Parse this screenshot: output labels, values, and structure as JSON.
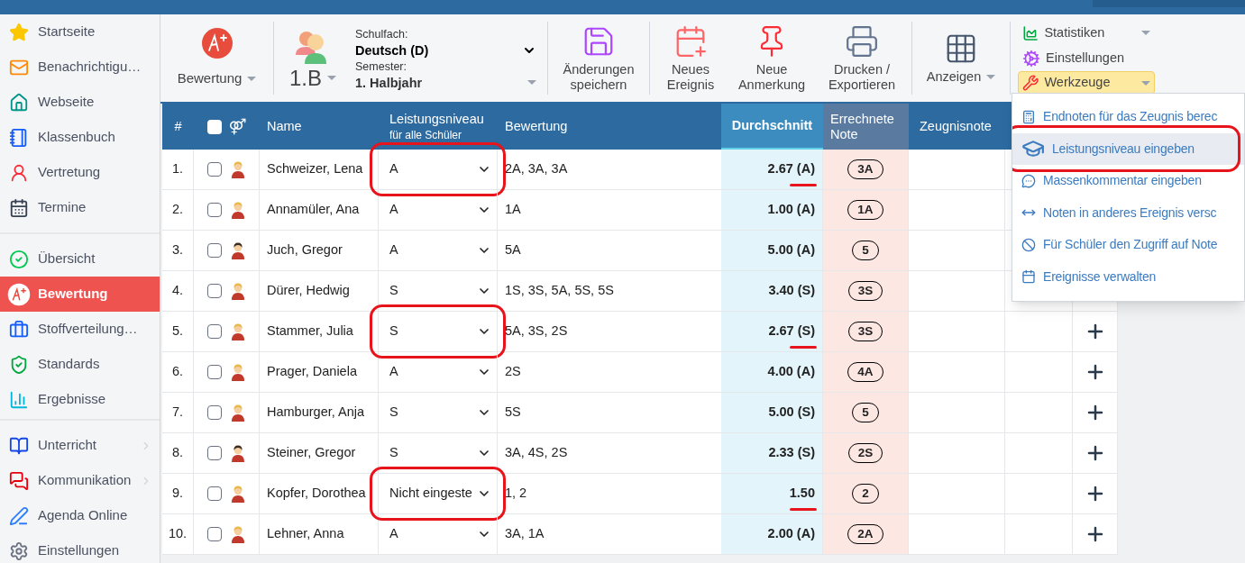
{
  "sidebar": {
    "groups": [
      {
        "items": [
          {
            "label": "Startseite",
            "selected": false
          },
          {
            "label": "Benachrichtigu…",
            "selected": false
          },
          {
            "label": "Webseite",
            "selected": false
          },
          {
            "label": "Klassenbuch",
            "selected": false
          },
          {
            "label": "Vertretung",
            "selected": false
          },
          {
            "label": "Termine",
            "selected": false
          }
        ]
      },
      {
        "items": [
          {
            "label": "Übersicht",
            "selected": false
          },
          {
            "label": "Bewertung",
            "selected": true
          },
          {
            "label": "Stoffverteilung…",
            "selected": false
          },
          {
            "label": "Standards",
            "selected": false
          },
          {
            "label": "Ergebnisse",
            "selected": false
          }
        ]
      },
      {
        "items": [
          {
            "label": "Unterricht",
            "selected": false,
            "submenu": true
          },
          {
            "label": "Kommunikation",
            "selected": false,
            "submenu": true
          },
          {
            "label": "Agenda Online",
            "selected": false,
            "submenu": false
          },
          {
            "label": "Einstellungen",
            "selected": false,
            "submenu": false
          }
        ]
      }
    ]
  },
  "toolbar": {
    "module": {
      "label": "Bewertung"
    },
    "class": {
      "label": "1.B"
    },
    "subject": {
      "label": "Schulfach:",
      "value": "Deutsch (D)"
    },
    "semester": {
      "label": "Semester:",
      "value": "1. Halbjahr"
    },
    "buttons": [
      {
        "label": "Änderungen speichern"
      },
      {
        "label": "Neues Ereignis"
      },
      {
        "label": "Neue Anmerkung"
      },
      {
        "label": "Drucken / Exportieren"
      },
      {
        "label": "Anzeigen",
        "dropdown": true
      }
    ],
    "side_buttons": [
      {
        "label": "Statistiken",
        "dropdown": true,
        "open": false
      },
      {
        "label": "Einstellungen",
        "dropdown": false,
        "open": false
      },
      {
        "label": "Werkzeuge",
        "dropdown": true,
        "open": true
      }
    ]
  },
  "table": {
    "select_all_checked": false,
    "columns": [
      {
        "label": "#"
      },
      {
        "label": "⚤"
      },
      {
        "label": "Name"
      },
      {
        "label": "Leistungsniveau",
        "sublabel": "für alle Schüler"
      },
      {
        "label": "Bewertung"
      },
      {
        "label": "Durchschnitt"
      },
      {
        "label": "Errechnete Note"
      },
      {
        "label": "Zeugnisnote"
      }
    ],
    "rows": [
      {
        "number": "1.",
        "checked": false,
        "kind": "female",
        "name": "Schweizer, Lena",
        "level": "A",
        "circled": true,
        "grades": "2A, 3A, 3A",
        "average": "2.67 (A)",
        "underlined": true,
        "computed": "3A"
      },
      {
        "number": "2.",
        "checked": false,
        "kind": "female",
        "name": "Annamüler, Ana",
        "level": "A",
        "circled": false,
        "grades": "1A",
        "average": "1.00 (A)",
        "underlined": false,
        "computed": "1A"
      },
      {
        "number": "3.",
        "checked": false,
        "kind": "male",
        "name": "Juch, Gregor",
        "level": "A",
        "circled": false,
        "grades": "5A",
        "average": "5.00 (A)",
        "underlined": false,
        "computed": "5"
      },
      {
        "number": "4.",
        "checked": false,
        "kind": "female",
        "name": "Dürer, Hedwig",
        "level": "S",
        "circled": false,
        "grades": "1S, 3S, 5A, 5S, 5S",
        "average": "3.40 (S)",
        "underlined": false,
        "computed": "3S"
      },
      {
        "number": "5.",
        "checked": false,
        "kind": "female",
        "name": "Stammer, Julia",
        "level": "S",
        "circled": true,
        "grades": "5A, 3S, 2S",
        "average": "2.67 (S)",
        "underlined": true,
        "computed": "3S",
        "add": true
      },
      {
        "number": "6.",
        "checked": false,
        "kind": "female",
        "name": "Prager, Daniela",
        "level": "A",
        "circled": false,
        "grades": "2S",
        "average": "4.00 (A)",
        "underlined": false,
        "computed": "4A",
        "add": true
      },
      {
        "number": "7.",
        "checked": false,
        "kind": "female",
        "name": "Hamburger, Anja",
        "level": "S",
        "circled": false,
        "grades": "5S",
        "average": "5.00 (S)",
        "underlined": false,
        "computed": "5",
        "add": true
      },
      {
        "number": "8.",
        "checked": false,
        "kind": "male",
        "name": "Steiner, Gregor",
        "level": "S",
        "circled": false,
        "grades": "3A, 4S, 2S",
        "average": "2.33 (S)",
        "underlined": false,
        "computed": "2S",
        "add": true
      },
      {
        "number": "9.",
        "checked": false,
        "kind": "female",
        "name": "Kopfer, Dorothea",
        "level": "Nicht eingeste",
        "circled": true,
        "grades": "1, 2",
        "average": "1.50",
        "underlined": true,
        "computed": "2",
        "add": true
      },
      {
        "number": "10.",
        "checked": false,
        "kind": "female",
        "name": "Lehner, Anna",
        "level": "A",
        "circled": false,
        "grades": "3A, 1A",
        "average": "2.00 (A)",
        "underlined": false,
        "computed": "2A",
        "add": true
      }
    ]
  },
  "tools_menu": {
    "items": [
      {
        "label": "Endnoten für das Zeugnis berec",
        "selected": false,
        "circled": false
      },
      {
        "label": "Leistungsniveau eingeben",
        "selected": true,
        "circled": true
      },
      {
        "label": "Massenkommentar eingeben",
        "selected": false,
        "circled": false
      },
      {
        "label": "Noten in anderes Ereignis versc",
        "selected": false,
        "circled": false
      },
      {
        "label": "Für Schüler den Zugriff auf Note",
        "selected": false,
        "circled": false
      },
      {
        "label": "Ereignisse verwalten",
        "selected": false,
        "circled": false
      }
    ]
  }
}
